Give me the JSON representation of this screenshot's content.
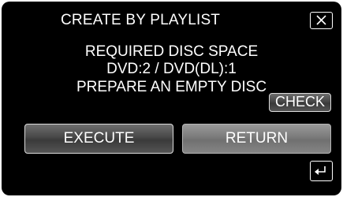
{
  "dialog": {
    "title": "CREATE BY PLAYLIST",
    "message_lines": [
      "REQUIRED DISC SPACE",
      "DVD:2 / DVD(DL):1",
      "PREPARE AN EMPTY DISC"
    ]
  },
  "buttons": {
    "check_label": "CHECK",
    "execute_label": "EXECUTE",
    "return_label": "RETURN"
  },
  "icons": {
    "close": "close-icon",
    "back": "back-arrow-icon"
  },
  "colors": {
    "background": "#000000",
    "text": "#ffffff",
    "button": "#4a4a4a",
    "button_highlighted": "#7a7a7a"
  }
}
